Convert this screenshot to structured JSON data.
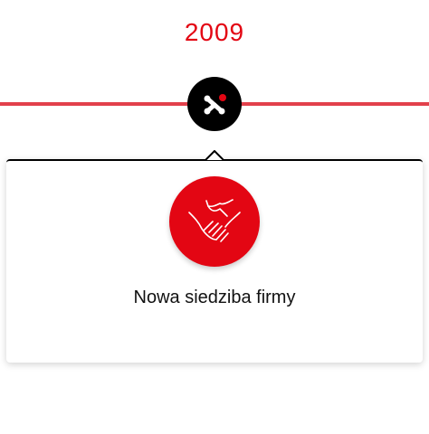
{
  "timeline": {
    "year": "2009",
    "node_icon": "logo-x-icon",
    "line_color": "#e2404b",
    "accent_color": "#e30613"
  },
  "card": {
    "icon": "handshake-icon",
    "title": "Nowa siedziba firmy"
  }
}
